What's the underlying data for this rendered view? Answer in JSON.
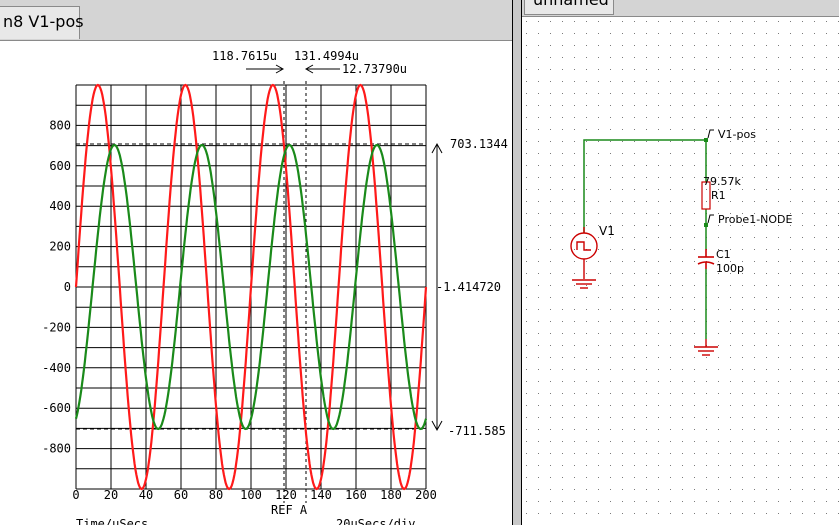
{
  "scope": {
    "tab_label": "n8 V1-pos",
    "cursor_a": "118.7615u",
    "cursor_b": "131.4994u",
    "cursor_delta": "12.73790u",
    "marker_upper": "703.1344",
    "marker_mid": "-1.414720",
    "marker_lower": "-711.585",
    "ref_label": "REF A",
    "x_label": "Time/uSecs",
    "x_scale_label": "20uSecs/div",
    "colors": {
      "trace_red": "#ff1a1a",
      "trace_green": "#1a8a1a",
      "grid": "#000000"
    }
  },
  "chart_data": {
    "type": "line",
    "x_ticks": [
      "0",
      "20",
      "40",
      "60",
      "80",
      "100",
      "120",
      "140",
      "160",
      "180",
      "200"
    ],
    "y_ticks": [
      "800",
      "600",
      "400",
      "200",
      "0",
      "-200",
      "-400",
      "-600",
      "-800"
    ],
    "xlim": [
      0,
      200
    ],
    "ylim": [
      -1000,
      1000
    ],
    "grid": true,
    "series": [
      {
        "color": "#ff1a1a",
        "amplitude": 1000,
        "period_us": 50,
        "phase_deg": 0
      },
      {
        "color": "#1a8a1a",
        "amplitude": 703,
        "period_us": 50,
        "phase_deg": -68
      }
    ]
  },
  "schematic": {
    "tab_label": "unnamed",
    "source_name": "V1",
    "node_v1": "V1-pos",
    "resistor_value": "79.57k",
    "resistor_name": "R1",
    "probe_node": "Probe1-NODE",
    "cap_name": "C1",
    "cap_value": "100p",
    "colors": {
      "wire": "#1a8a1a",
      "part": "#cc0000",
      "node": "#1a8a1a"
    }
  }
}
